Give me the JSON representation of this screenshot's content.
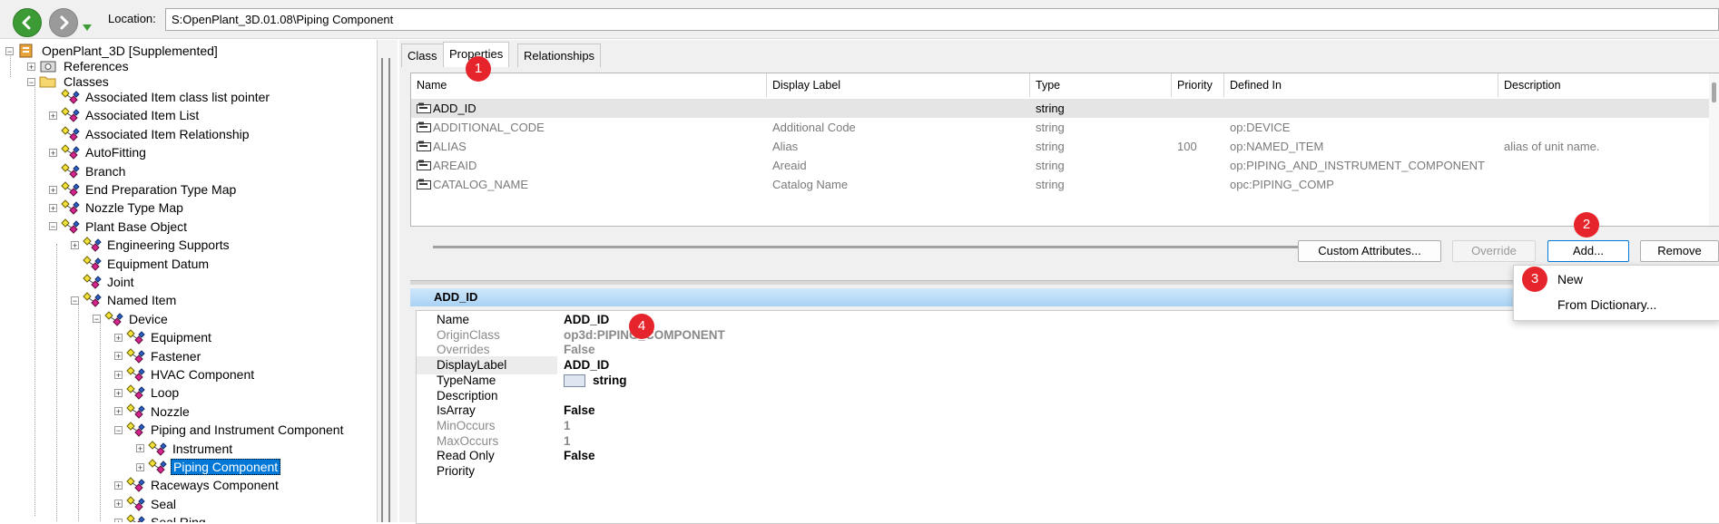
{
  "toolbar": {
    "location_label": "Location:",
    "location_value": "S:OpenPlant_3D.01.08\\Piping Component",
    "back_icon": "back-arrow-icon",
    "forward_icon": "forward-arrow-icon",
    "dropdown_icon": "green-down-triangle-icon"
  },
  "tree": {
    "root": "OpenPlant_3D [Supplemented]",
    "references": "References",
    "classes": "Classes",
    "items": [
      "Associated Item class list pointer",
      "Associated Item List",
      "Associated Item Relationship",
      "AutoFitting",
      "Branch",
      "End Preparation Type Map",
      "Nozzle Type Map",
      "Plant Base Object",
      "Engineering Supports",
      "Equipment Datum",
      "Joint",
      "Named Item",
      "Device",
      "Equipment",
      "Fastener",
      "HVAC Component",
      "Loop",
      "Nozzle",
      "Piping and Instrument Component",
      "Instrument",
      "Piping Component",
      "Raceways Component",
      "Seal",
      "Seal Ring"
    ]
  },
  "tabs": [
    "Class",
    "Properties",
    "Relationships"
  ],
  "grid": {
    "headers": [
      "Name",
      "Display Label",
      "Type",
      "Priority",
      "Defined In",
      "Description"
    ],
    "rows": [
      {
        "name": "ADD_ID",
        "label": "",
        "type": "string",
        "priority": "",
        "defined": "",
        "desc": ""
      },
      {
        "name": "ADDITIONAL_CODE",
        "label": "Additional Code",
        "type": "string",
        "priority": "",
        "defined": "op:DEVICE",
        "desc": ""
      },
      {
        "name": "ALIAS",
        "label": "Alias",
        "type": "string",
        "priority": "100",
        "defined": "op:NAMED_ITEM",
        "desc": "alias of unit name."
      },
      {
        "name": "AREAID",
        "label": "Areaid",
        "type": "string",
        "priority": "",
        "defined": "op:PIPING_AND_INSTRUMENT_COMPONENT",
        "desc": ""
      },
      {
        "name": "CATALOG_NAME",
        "label": "Catalog Name",
        "type": "string",
        "priority": "",
        "defined": "opc:PIPING_COMP",
        "desc": ""
      }
    ]
  },
  "buttons": {
    "custom": "Custom Attributes...",
    "override": "Override",
    "add": "Add...",
    "remove": "Remove"
  },
  "menu": {
    "new": "New",
    "from_dictionary": "From Dictionary..."
  },
  "detail": {
    "title": "ADD_ID",
    "props": [
      {
        "key": "Name",
        "value": "ADD_ID"
      },
      {
        "key": "OriginClass",
        "value": "op3d:PIPING_COMPONENT"
      },
      {
        "key": "Overrides",
        "value": "False"
      },
      {
        "key": "DisplayLabel",
        "value": "ADD_ID"
      },
      {
        "key": "TypeName",
        "value": "string"
      },
      {
        "key": "Description",
        "value": ""
      },
      {
        "key": "IsArray",
        "value": "False"
      },
      {
        "key": "MinOccurs",
        "value": "1"
      },
      {
        "key": "MaxOccurs",
        "value": "1"
      },
      {
        "key": "Read Only",
        "value": "False"
      },
      {
        "key": "Priority",
        "value": ""
      }
    ]
  },
  "badges": [
    "1",
    "2",
    "3",
    "4"
  ],
  "colors": {
    "selection": "#0078d7",
    "badge": "#e5242b",
    "header_blue": "#a9d2f4"
  }
}
